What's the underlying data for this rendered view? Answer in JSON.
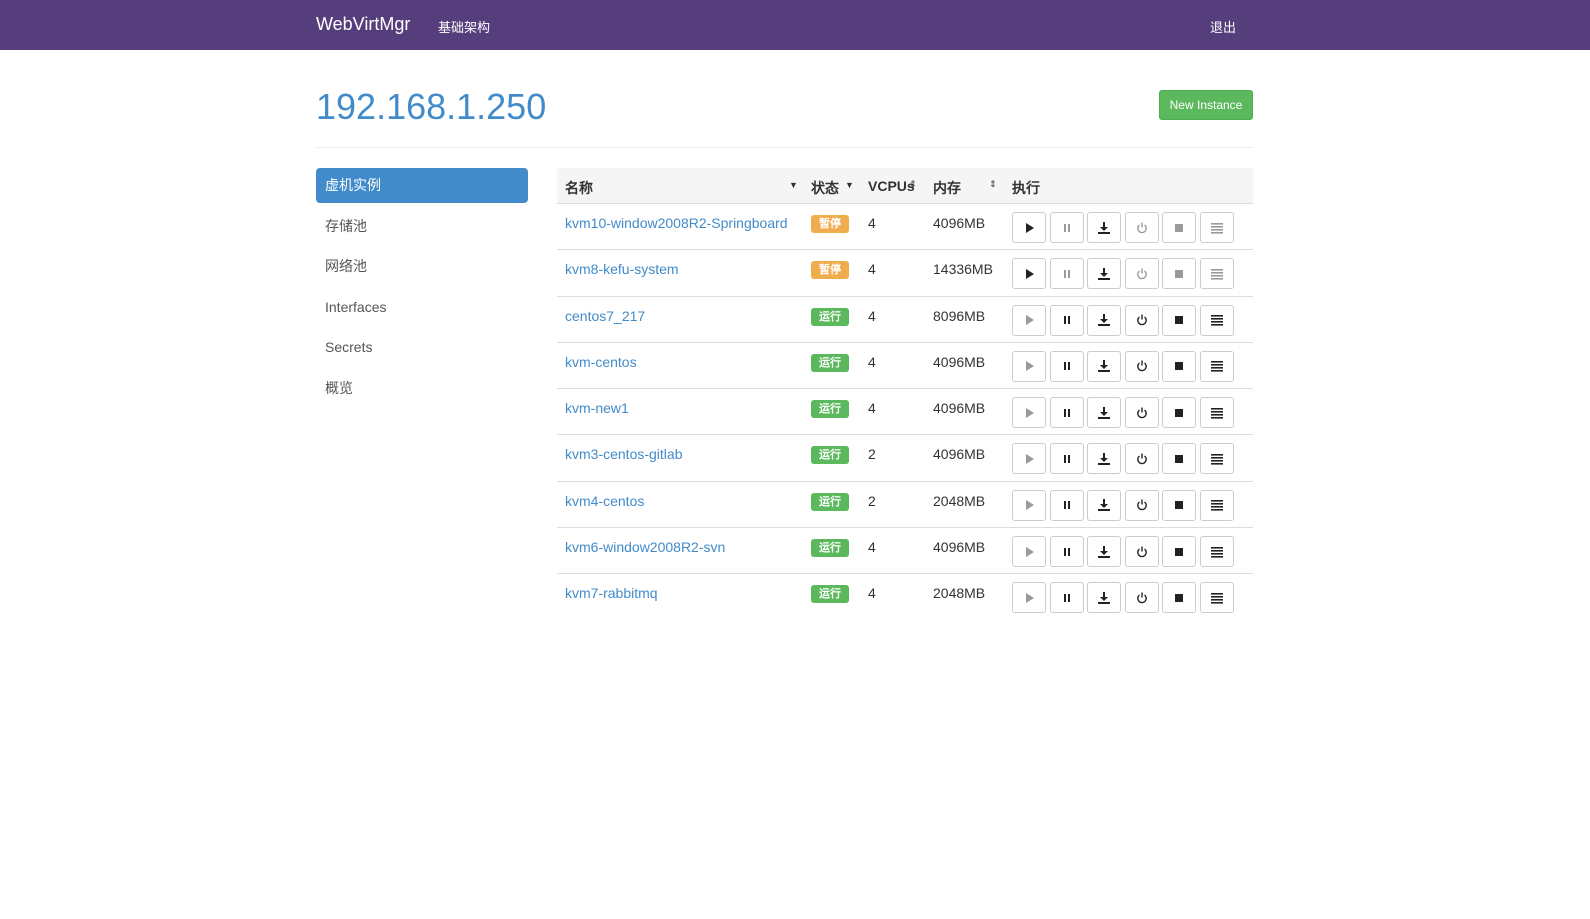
{
  "navbar": {
    "brand": "WebVirtMgr",
    "infra_link": "基础架构",
    "logout_link": "退出"
  },
  "page": {
    "title": "192.168.1.250",
    "new_instance_label": "New Instance"
  },
  "sidebar": {
    "items": [
      {
        "label": "虚机实例",
        "active": true
      },
      {
        "label": "存储池",
        "active": false
      },
      {
        "label": "网络池",
        "active": false
      },
      {
        "label": "Interfaces",
        "active": false
      },
      {
        "label": "Secrets",
        "active": false
      },
      {
        "label": "概览",
        "active": false
      }
    ]
  },
  "table": {
    "headers": {
      "name": "名称",
      "status": "状态",
      "vcpu": "VCPUs",
      "memory": "内存",
      "actions": "执行"
    },
    "status_colors": {
      "暂停": "#f0ad4e",
      "运行": "#5cb85c"
    },
    "action_icons": [
      "play-icon",
      "pause-icon",
      "download-icon",
      "power-icon",
      "stop-icon",
      "menu-icon"
    ],
    "rows": [
      {
        "name": "kvm10-window2008R2-Springboard",
        "status": "暂停",
        "vcpu": "4",
        "memory": "4096MB"
      },
      {
        "name": "kvm8-kefu-system",
        "status": "暂停",
        "vcpu": "4",
        "memory": "14336MB"
      },
      {
        "name": "centos7_217",
        "status": "运行",
        "vcpu": "4",
        "memory": "8096MB"
      },
      {
        "name": "kvm-centos",
        "status": "运行",
        "vcpu": "4",
        "memory": "4096MB"
      },
      {
        "name": "kvm-new1",
        "status": "运行",
        "vcpu": "4",
        "memory": "4096MB"
      },
      {
        "name": "kvm3-centos-gitlab",
        "status": "运行",
        "vcpu": "2",
        "memory": "4096MB"
      },
      {
        "name": "kvm4-centos",
        "status": "运行",
        "vcpu": "2",
        "memory": "2048MB"
      },
      {
        "name": "kvm6-window2008R2-svn",
        "status": "运行",
        "vcpu": "4",
        "memory": "4096MB"
      },
      {
        "name": "kvm7-rabbitmq",
        "status": "运行",
        "vcpu": "4",
        "memory": "2048MB"
      }
    ]
  }
}
